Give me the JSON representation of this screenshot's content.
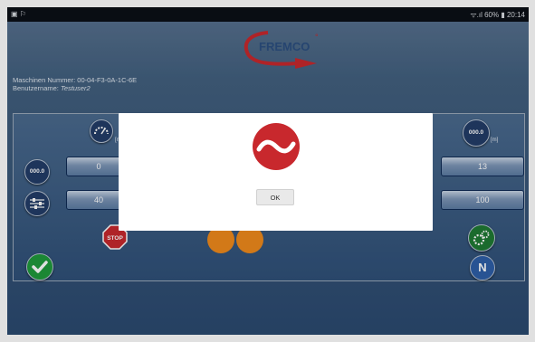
{
  "status_bar": {
    "left_icons": "▣ ⚐",
    "right_text": "ᯤ.ıl 60% ▮ 20:14"
  },
  "header": {
    "logo_text": "FREMCO",
    "logo_mark": "°"
  },
  "machine": {
    "number_label": "Maschinen Nummer:",
    "number_value": "00-04-F3-0A-1C-6E",
    "user_label": "Benutzername:",
    "user_value": "Testuser2"
  },
  "panel": {
    "left_gauge_unit": "[m",
    "right_counter_text": "000.0",
    "right_counter_unit": "[m]",
    "left_counter_text": "000.0",
    "row1_left_value": "0",
    "row1_right_value": "13",
    "row2_left_value": "40",
    "row2_right_value": "100",
    "stop_label": "STOP",
    "n_label": "N"
  },
  "dialog": {
    "ok_label": "OK"
  },
  "colors": {
    "brand_red": "#c8282d",
    "panel_blue": "#2b4a70",
    "dialog_bg": "#ffffff",
    "confirm_green": "#1f9a3c"
  },
  "icons": [
    "speed-gauge-icon",
    "counter-icon",
    "slider-settings-icon",
    "stop-icon",
    "rotate-icons",
    "gears-icon",
    "checkmark-icon",
    "n-badge-icon",
    "fremco-wave-icon"
  ]
}
